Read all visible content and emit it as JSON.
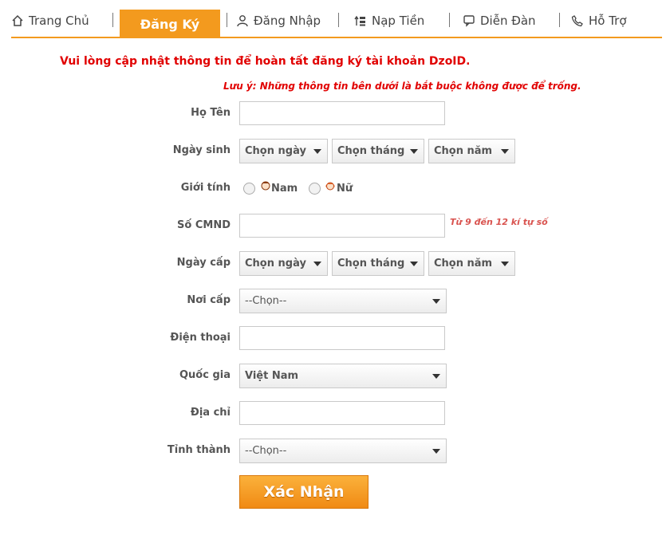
{
  "nav": {
    "items": [
      {
        "label": "Trang Chủ",
        "icon": "home-icon"
      },
      {
        "label": "Đăng Ký",
        "active": true
      },
      {
        "label": "Đăng Nhập",
        "icon": "user-icon"
      },
      {
        "label": "Nạp Tiền",
        "icon": "topup-icon"
      },
      {
        "label": "Diễn Đàn",
        "icon": "chat-icon"
      },
      {
        "label": "Hỗ Trợ",
        "icon": "phone-icon"
      }
    ],
    "accent": "#f39a1e"
  },
  "notice": "Vui lòng cập nhật thông tin để hoàn tất đăng ký tài khoản DzoID.",
  "note": "Lưu ý: Những thông tin bên dưới là bắt buộc không được để trống.",
  "form": {
    "fullname_label": "Họ Tên",
    "birth_label": "Ngày sinh",
    "birth": {
      "day": "Chọn ngày",
      "month": "Chọn tháng",
      "year": "Chọn năm"
    },
    "gender_label": "Giới tính",
    "gender_male": "Nam",
    "gender_female": "Nữ",
    "id_label": "Số CMND",
    "id_hint": "Từ 9 đến 12 kí tự số",
    "issue_date_label": "Ngày cấp",
    "issue_date": {
      "day": "Chọn ngày",
      "month": "Chọn tháng",
      "year": "Chọn năm"
    },
    "issue_place_label": "Nơi cấp",
    "issue_place_value": "--Chọn--",
    "phone_label": "Điện thoại",
    "country_label": "Quốc gia",
    "country_value": "Việt Nam",
    "address_label": "Địa chỉ",
    "province_label": "Tỉnh thành",
    "province_value": "--Chọn--",
    "submit_label": "Xác Nhận"
  }
}
